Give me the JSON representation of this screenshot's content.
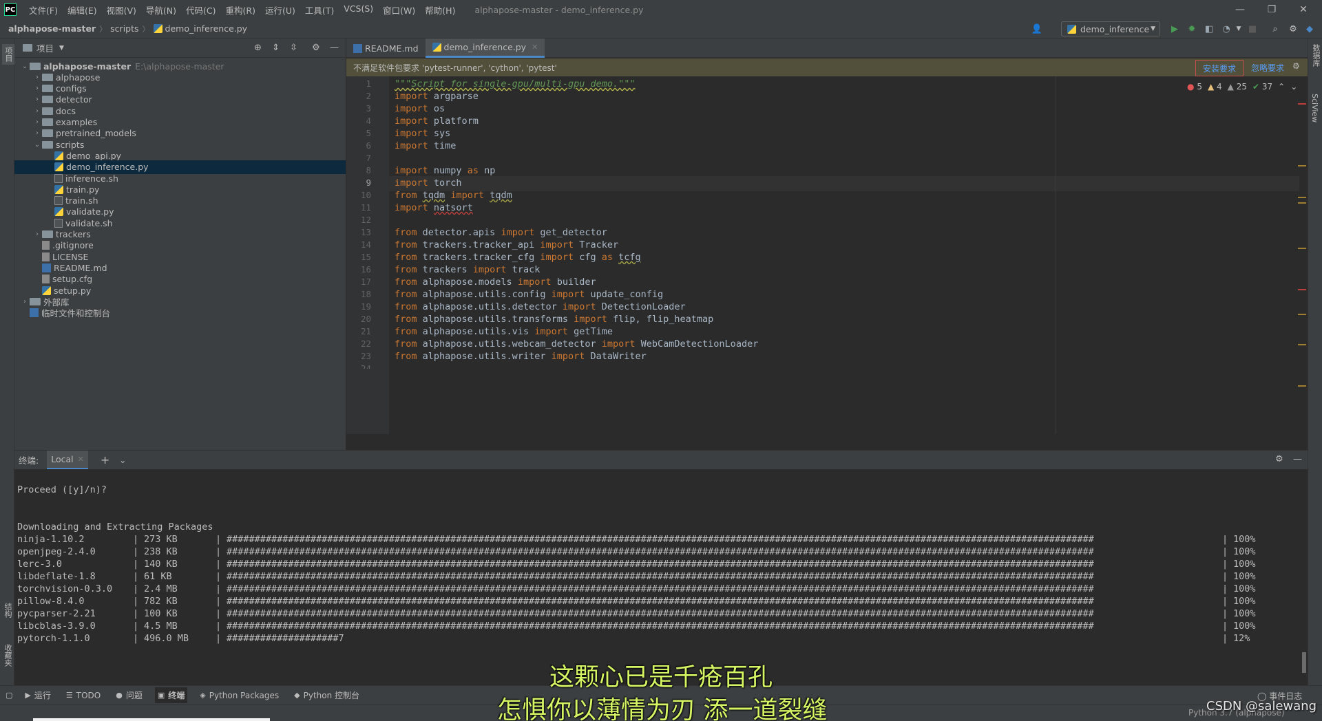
{
  "titlebar": {
    "logo": "PC",
    "menus": [
      "文件(F)",
      "编辑(E)",
      "视图(V)",
      "导航(N)",
      "代码(C)",
      "重构(R)",
      "运行(U)",
      "工具(T)",
      "VCS(S)",
      "窗口(W)",
      "帮助(H)"
    ],
    "window_title": "alphapose-master - demo_inference.py"
  },
  "navbar": {
    "breadcrumb": [
      "alphapose-master",
      "scripts",
      "demo_inference.py"
    ],
    "run_config": "demo_inference"
  },
  "left_stripe": {
    "project_label": "项目",
    "structure_label": "结构",
    "bookmarks_label": "收藏夹"
  },
  "right_stripe": {
    "database_label": "数据库",
    "sciview_label": "SciView"
  },
  "project_panel": {
    "title": "项目",
    "tree": [
      {
        "label": "alphapose-master",
        "hint": "E:\\alphapose-master",
        "depth": 0,
        "arrow": "down",
        "icon": "folder",
        "bold": true
      },
      {
        "label": "alphapose",
        "depth": 1,
        "arrow": "right",
        "icon": "folder"
      },
      {
        "label": "configs",
        "depth": 1,
        "arrow": "right",
        "icon": "folder"
      },
      {
        "label": "detector",
        "depth": 1,
        "arrow": "right",
        "icon": "folder"
      },
      {
        "label": "docs",
        "depth": 1,
        "arrow": "right",
        "icon": "folder"
      },
      {
        "label": "examples",
        "depth": 1,
        "arrow": "right",
        "icon": "folder"
      },
      {
        "label": "pretrained_models",
        "depth": 1,
        "arrow": "right",
        "icon": "folder"
      },
      {
        "label": "scripts",
        "depth": 1,
        "arrow": "down",
        "icon": "folder"
      },
      {
        "label": "demo_api.py",
        "depth": 2,
        "icon": "py"
      },
      {
        "label": "demo_inference.py",
        "depth": 2,
        "icon": "py",
        "selected": true
      },
      {
        "label": "inference.sh",
        "depth": 2,
        "icon": "sh"
      },
      {
        "label": "train.py",
        "depth": 2,
        "icon": "py"
      },
      {
        "label": "train.sh",
        "depth": 2,
        "icon": "sh"
      },
      {
        "label": "validate.py",
        "depth": 2,
        "icon": "py"
      },
      {
        "label": "validate.sh",
        "depth": 2,
        "icon": "sh"
      },
      {
        "label": "trackers",
        "depth": 1,
        "arrow": "right",
        "icon": "folder"
      },
      {
        "label": ".gitignore",
        "depth": 1,
        "icon": "txt"
      },
      {
        "label": "LICENSE",
        "depth": 1,
        "icon": "txt"
      },
      {
        "label": "README.md",
        "depth": 1,
        "icon": "md"
      },
      {
        "label": "setup.cfg",
        "depth": 1,
        "icon": "txt"
      },
      {
        "label": "setup.py",
        "depth": 1,
        "icon": "py"
      },
      {
        "label": "外部库",
        "depth": 0,
        "arrow": "right",
        "icon": "lib"
      },
      {
        "label": "临时文件和控制台",
        "depth": 0,
        "icon": "scratch"
      }
    ]
  },
  "editor": {
    "tabs": [
      {
        "label": "README.md",
        "active": false
      },
      {
        "label": "demo_inference.py",
        "active": true
      }
    ],
    "banner_text": "不满足软件包要求 'pytest-runner', 'cython', 'pytest'",
    "install_label": "安装要求",
    "ignore_label": "忽略要求",
    "inspections": {
      "errors": "5",
      "warnings": "4",
      "weak": "25",
      "ok": "37"
    },
    "current_line": 9,
    "lines": [
      "\"\"\"Script for single-gpu/multi-gpu demo.\"\"\"",
      "import argparse",
      "import os",
      "import platform",
      "import sys",
      "import time",
      "",
      "import numpy as np",
      "import torch",
      "from tqdm import tqdm",
      "import natsort",
      "",
      "from detector.apis import get_detector",
      "from trackers.tracker_api import Tracker",
      "from trackers.tracker_cfg import cfg as tcfg",
      "from trackers import track",
      "from alphapose.models import builder",
      "from alphapose.utils.config import update_config",
      "from alphapose.utils.detector import DetectionLoader",
      "from alphapose.utils.transforms import flip, flip_heatmap",
      "from alphapose.utils.vis import getTime",
      "from alphapose.utils.webcam_detector import WebCamDetectionLoader",
      "from alphapose.utils.writer import DataWriter"
    ],
    "next_line_number": "24"
  },
  "terminal": {
    "label": "终端:",
    "tab": "Local",
    "prompt": "Proceed ([y]/n)?",
    "heading": "Downloading and Extracting Packages",
    "packages": [
      {
        "name": "ninja-1.10.2",
        "size": "273 KB",
        "bar": "###########################################################################################################################################################",
        "pct": "100%"
      },
      {
        "name": "openjpeg-2.4.0",
        "size": "238 KB",
        "bar": "###########################################################################################################################################################",
        "pct": "100%"
      },
      {
        "name": "lerc-3.0",
        "size": "140 KB",
        "bar": "###########################################################################################################################################################",
        "pct": "100%"
      },
      {
        "name": "libdeflate-1.8",
        "size": "61 KB",
        "bar": "###########################################################################################################################################################",
        "pct": "100%"
      },
      {
        "name": "torchvision-0.3.0",
        "size": "2.4 MB",
        "bar": "###########################################################################################################################################################",
        "pct": "100%"
      },
      {
        "name": "pillow-8.4.0",
        "size": "782 KB",
        "bar": "###########################################################################################################################################################",
        "pct": "100%"
      },
      {
        "name": "pycparser-2.21",
        "size": "100 KB",
        "bar": "###########################################################################################################################################################",
        "pct": "100%"
      },
      {
        "name": "libcblas-3.9.0",
        "size": "4.5 MB",
        "bar": "###########################################################################################################################################################",
        "pct": "100%"
      },
      {
        "name": "pytorch-1.1.0",
        "size": "496.0 MB",
        "bar": "####################7",
        "pct": "12%"
      }
    ]
  },
  "bottom_bar": {
    "items": [
      {
        "label": "运行",
        "icon": "▶"
      },
      {
        "label": "TODO",
        "icon": "☰"
      },
      {
        "label": "问题",
        "icon": "●"
      },
      {
        "label": "终端",
        "icon": "▣",
        "active": true
      },
      {
        "label": "Python Packages",
        "icon": "◈"
      },
      {
        "label": "Python 控制台",
        "icon": "◆"
      }
    ],
    "event_log": "事件日志"
  },
  "status": {
    "interpreter": "Python 3.7 (alphapose)"
  },
  "overlay": {
    "subtitle_1": "这颗心已是千疮百孔",
    "subtitle_2": "怎惧你以薄情为刃 添一道裂缝",
    "watermark": "CSDN @salewang"
  },
  "colors": {
    "accent": "#4a88c7",
    "keyword": "#cc7832",
    "docstring": "#629755",
    "subtitle": "#d6f564"
  }
}
